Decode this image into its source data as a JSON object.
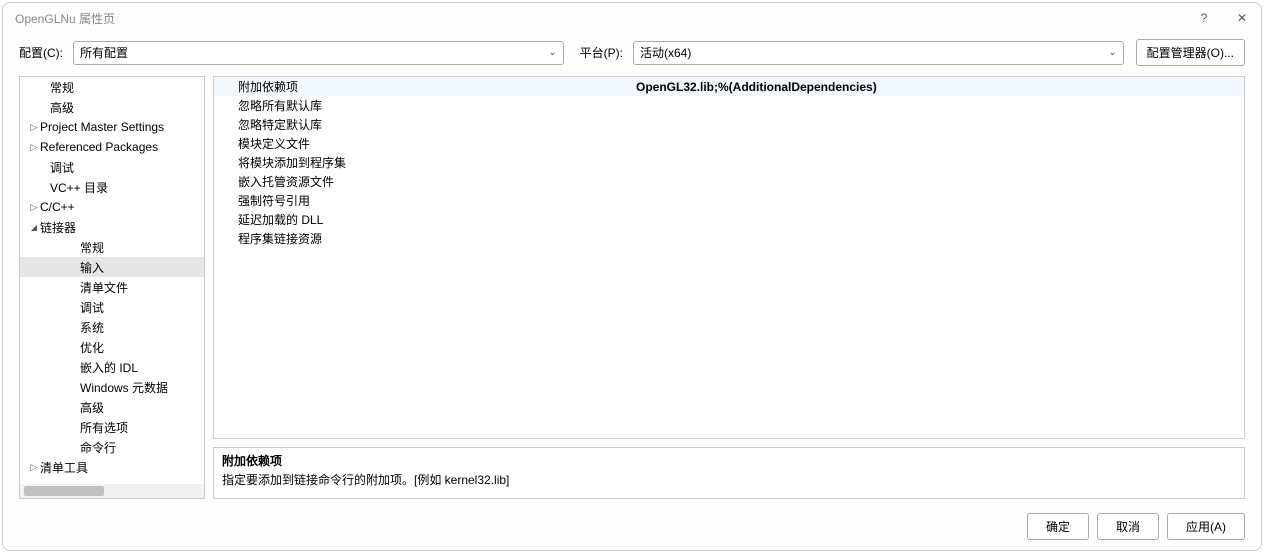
{
  "window_title": "OpenGLNu 属性页",
  "toolbar": {
    "config_label": "配置(C):",
    "config_value": "所有配置",
    "platform_label": "平台(P):",
    "platform_value": "活动(x64)",
    "config_mgr": "配置管理器(O)..."
  },
  "tree": [
    {
      "label": "常规",
      "level": 1,
      "arrow": "none"
    },
    {
      "label": "高级",
      "level": 1,
      "arrow": "none"
    },
    {
      "label": "Project Master Settings",
      "level": 0,
      "arrow": "right"
    },
    {
      "label": "Referenced Packages",
      "level": 0,
      "arrow": "right"
    },
    {
      "label": "调试",
      "level": 1,
      "arrow": "none"
    },
    {
      "label": "VC++ 目录",
      "level": 1,
      "arrow": "none"
    },
    {
      "label": "C/C++",
      "level": 0,
      "arrow": "right"
    },
    {
      "label": "链接器",
      "level": 0,
      "arrow": "down"
    },
    {
      "label": "常规",
      "level": 2,
      "arrow": "none"
    },
    {
      "label": "输入",
      "level": 2,
      "arrow": "none",
      "selected": true
    },
    {
      "label": "清单文件",
      "level": 2,
      "arrow": "none"
    },
    {
      "label": "调试",
      "level": 2,
      "arrow": "none"
    },
    {
      "label": "系统",
      "level": 2,
      "arrow": "none"
    },
    {
      "label": "优化",
      "level": 2,
      "arrow": "none"
    },
    {
      "label": "嵌入的 IDL",
      "level": 2,
      "arrow": "none"
    },
    {
      "label": "Windows 元数据",
      "level": 2,
      "arrow": "none"
    },
    {
      "label": "高级",
      "level": 2,
      "arrow": "none"
    },
    {
      "label": "所有选项",
      "level": 2,
      "arrow": "none"
    },
    {
      "label": "命令行",
      "level": 2,
      "arrow": "none"
    },
    {
      "label": "清单工具",
      "level": 0,
      "arrow": "right"
    }
  ],
  "props": [
    {
      "name": "附加依赖项",
      "value": "OpenGL32.lib;%(AdditionalDependencies)",
      "bold": true,
      "selected": true
    },
    {
      "name": "忽略所有默认库",
      "value": ""
    },
    {
      "name": "忽略特定默认库",
      "value": ""
    },
    {
      "name": "模块定义文件",
      "value": ""
    },
    {
      "name": "将模块添加到程序集",
      "value": ""
    },
    {
      "name": "嵌入托管资源文件",
      "value": ""
    },
    {
      "name": "强制符号引用",
      "value": ""
    },
    {
      "name": "延迟加载的 DLL",
      "value": ""
    },
    {
      "name": "程序集链接资源",
      "value": ""
    }
  ],
  "description": {
    "title": "附加依赖项",
    "text": "指定要添加到链接命令行的附加项。[例如 kernel32.lib]"
  },
  "buttons": {
    "ok": "确定",
    "cancel": "取消",
    "apply": "应用(A)"
  }
}
